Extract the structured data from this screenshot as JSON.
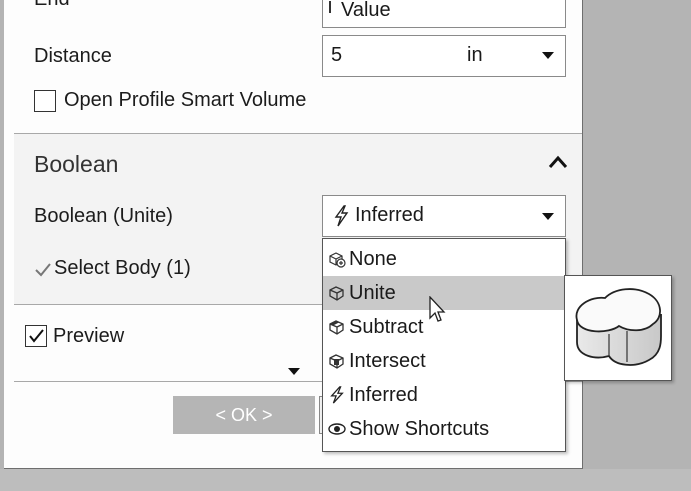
{
  "extent": {
    "end_label": "End",
    "end_value": "Value",
    "distance_label": "Distance",
    "distance_value": "5",
    "distance_unit": "in",
    "open_profile_label": "Open Profile Smart Volume"
  },
  "boolean_section": {
    "title": "Boolean",
    "boolean_label": "Boolean (Unite)",
    "boolean_value": "Inferred",
    "select_body_label": "Select Body (1)",
    "menu": [
      {
        "label": "None",
        "icon": "none-icon"
      },
      {
        "label": "Unite",
        "icon": "unite-icon"
      },
      {
        "label": "Subtract",
        "icon": "subtract-icon"
      },
      {
        "label": "Intersect",
        "icon": "intersect-icon"
      },
      {
        "label": "Inferred",
        "icon": "lightning-icon"
      },
      {
        "label": "Show Shortcuts",
        "icon": "eye-icon"
      }
    ],
    "highlighted_index": 1
  },
  "footer": {
    "preview_label": "Preview",
    "preview_checked": true,
    "ok_label": "< OK >"
  },
  "colors": {
    "panel_bg": "#fdfdfd",
    "menu_highlight": "#c9c9c9",
    "ok_button_bg": "#b5b5b5"
  }
}
